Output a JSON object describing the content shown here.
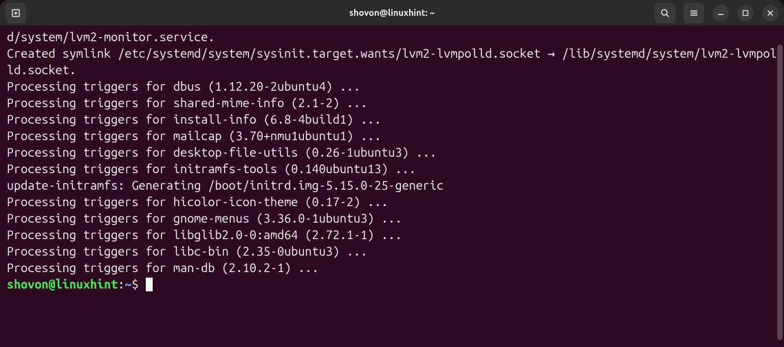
{
  "titlebar": {
    "title": "shovon@linuxhint: ~"
  },
  "terminal": {
    "lines": [
      "d/system/lvm2-monitor.service.",
      "Created symlink /etc/systemd/system/sysinit.target.wants/lvm2-lvmpolld.socket → /lib/systemd/system/lvm2-lvmpolld.socket.",
      "Processing triggers for dbus (1.12.20-2ubuntu4) ...",
      "Processing triggers for shared-mime-info (2.1-2) ...",
      "Processing triggers for install-info (6.8-4build1) ...",
      "Processing triggers for mailcap (3.70+nmu1ubuntu1) ...",
      "Processing triggers for desktop-file-utils (0.26-1ubuntu3) ...",
      "Processing triggers for initramfs-tools (0.140ubuntu13) ...",
      "update-initramfs: Generating /boot/initrd.img-5.15.0-25-generic",
      "Processing triggers for hicolor-icon-theme (0.17-2) ...",
      "Processing triggers for gnome-menus (3.36.0-1ubuntu3) ...",
      "Processing triggers for libglib2.0-0:amd64 (2.72.1-1) ...",
      "Processing triggers for libc-bin (2.35-0ubuntu3) ...",
      "Processing triggers for man-db (2.10.2-1) ..."
    ],
    "prompt": {
      "user_host": "shovon@linuxhint",
      "sep1": ":",
      "path": "~",
      "sep2": "$"
    }
  }
}
